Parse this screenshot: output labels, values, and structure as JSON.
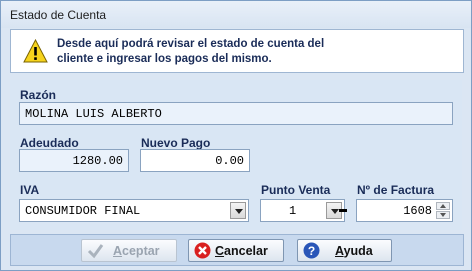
{
  "window": {
    "title": "Estado de Cuenta"
  },
  "info": {
    "icon": "warning-icon",
    "line1": "Desde aquí podrá revisar el estado de cuenta del",
    "line2": "cliente e ingresar los pagos del mismo."
  },
  "form": {
    "razon_label": "Razón",
    "razon_value": "MOLINA LUIS ALBERTO",
    "adeudado_label": "Adeudado",
    "adeudado_value": "1280.00",
    "nuevo_pago_label": "Nuevo Pago",
    "nuevo_pago_value": "0.00",
    "iva_label": "IVA",
    "iva_value": "CONSUMIDOR FINAL",
    "punto_venta_label": "Punto Venta",
    "punto_venta_value": "1",
    "factura_label": "Nº de Factura",
    "factura_value": "1608"
  },
  "buttons": {
    "aceptar_first": "A",
    "aceptar_rest": "ceptar",
    "cancelar_first": "C",
    "cancelar_rest": "ancelar",
    "ayuda_first": "A",
    "ayuda_rest": "yuda"
  },
  "colors": {
    "accent": "#1a2c58",
    "cancel_icon": "#d92020",
    "help_icon": "#2a56b8"
  }
}
